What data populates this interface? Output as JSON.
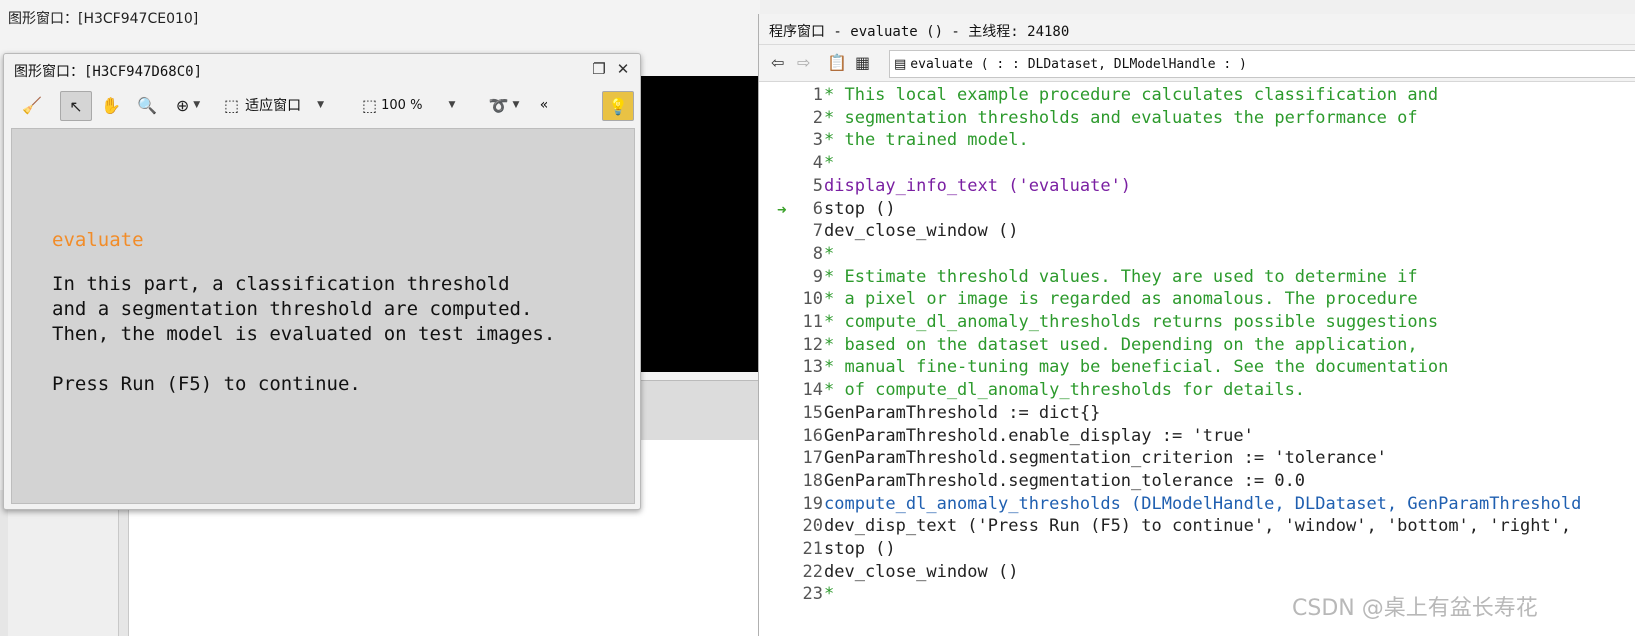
{
  "bg_window": {
    "title": "图形窗口：[H3CF947CE010]"
  },
  "fg_window": {
    "title": "图形窗口：[H3CF947D68C0]",
    "toolbar": {
      "fit_label": "适应窗口",
      "zoom_label": "100 %",
      "more_label": "«"
    },
    "message": {
      "title": "evaluate",
      "lines": [
        "In this part, a classification threshold",
        "and a segmentation threshold are computed.",
        "Then, the model is evaluated on test images.",
        "",
        "Press Run (F5) to continue."
      ]
    }
  },
  "program_window": {
    "title": "程序窗口 - evaluate () - 主线程: 24180",
    "procedure_signature": "evaluate ( : : DLDataset, DLModelHandle : )",
    "pc_line": 6,
    "lines": [
      {
        "n": "1",
        "text": "* This local example procedure calculates classification and",
        "type": "comment"
      },
      {
        "n": "2",
        "text": "* segmentation thresholds and evaluates the performance of",
        "type": "comment"
      },
      {
        "n": "3",
        "text": "* the trained model.",
        "type": "comment"
      },
      {
        "n": "4",
        "text": "*",
        "type": "comment"
      },
      {
        "n": "5",
        "text": "display_info_text ('evaluate')",
        "type": "proc"
      },
      {
        "n": "6",
        "text": "stop ()",
        "type": "plain"
      },
      {
        "n": "7",
        "text": "dev_close_window ()",
        "type": "plain"
      },
      {
        "n": "8",
        "text": "*",
        "type": "comment"
      },
      {
        "n": "9",
        "text": "* Estimate threshold values. They are used to determine if",
        "type": "comment"
      },
      {
        "n": "10",
        "text": "* a pixel or image is regarded as anomalous. The procedure",
        "type": "comment"
      },
      {
        "n": "11",
        "text": "* compute_dl_anomaly_thresholds returns possible suggestions",
        "type": "comment"
      },
      {
        "n": "12",
        "text": "* based on the dataset used. Depending on the application,",
        "type": "comment"
      },
      {
        "n": "13",
        "text": "* manual fine-tuning may be beneficial. See the documentation",
        "type": "comment"
      },
      {
        "n": "14",
        "text": "* of compute_dl_anomaly_thresholds for details.",
        "type": "comment"
      },
      {
        "n": "15",
        "text": "GenParamThreshold := dict{}",
        "type": "plain"
      },
      {
        "n": "16",
        "text": "GenParamThreshold.enable_display := 'true'",
        "type": "plain"
      },
      {
        "n": "17",
        "text": "GenParamThreshold.segmentation_criterion := 'tolerance'",
        "type": "plain"
      },
      {
        "n": "18",
        "text": "GenParamThreshold.segmentation_tolerance := 0.0",
        "type": "plain"
      },
      {
        "n": "19",
        "text": "compute_dl_anomaly_thresholds (DLModelHandle, DLDataset, GenParamThreshold",
        "type": "call"
      },
      {
        "n": "20",
        "text": "dev_disp_text ('Press Run (F5) to continue', 'window', 'bottom', 'right',",
        "type": "plain"
      },
      {
        "n": "21",
        "text": "stop ()",
        "type": "plain"
      },
      {
        "n": "22",
        "text": "dev_close_window ()",
        "type": "plain"
      },
      {
        "n": "23",
        "text": "*",
        "type": "comment"
      }
    ]
  },
  "watermark": "CSDN @桌上有盆长寿花"
}
